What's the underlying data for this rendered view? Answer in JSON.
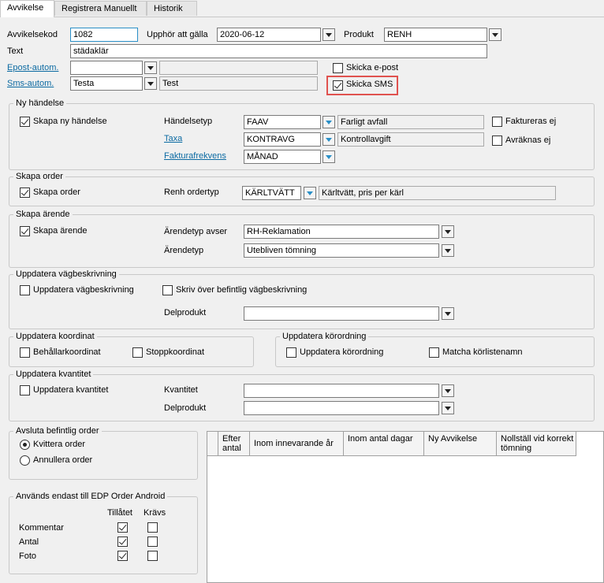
{
  "tabs": [
    "Avvikelse",
    "Registrera Manuellt",
    "Historik"
  ],
  "fields": {
    "avvikelsekod_label": "Avvikelsekod",
    "avvikelsekod": "1082",
    "upphor_label": "Upphör att gälla",
    "upphor": "2020-06-12",
    "produkt_label": "Produkt",
    "produkt": "RENH",
    "text_label": "Text",
    "text": "städaklär",
    "epost_label": "Epost-autom.",
    "epost": "",
    "epost_desc": "",
    "sms_label": "Sms-autom.",
    "sms": "Testa",
    "sms_desc": "Test",
    "skicka_epost": "Skicka e-post",
    "skicka_sms": "Skicka SMS"
  },
  "ny_handelse": {
    "title": "Ny händelse",
    "skapa": "Skapa ny händelse",
    "handelsetyp_label": "Händelsetyp",
    "handelsetyp": "FAAV",
    "handelsetyp_desc": "Farligt avfall",
    "taxa_label": "Taxa",
    "taxa": "KONTRAVG",
    "taxa_desc": "Kontrollavgift",
    "fakturafrekvens_label": "Fakturafrekvens",
    "fakturafrekvens": "MÅNAD",
    "faktureras_ej": "Faktureras ej",
    "avraknas_ej": "Avräknas ej"
  },
  "skapa_order": {
    "title": "Skapa order",
    "skapa": "Skapa order",
    "ordertyp_label": "Renh ordertyp",
    "ordertyp": "KÄRLTVÄTT",
    "ordertyp_desc": "Kärltvätt, pris per kärl"
  },
  "skapa_arende": {
    "title": "Skapa ärende",
    "skapa": "Skapa ärende",
    "avser_label": "Ärendetyp avser",
    "avser": "RH-Reklamation",
    "typ_label": "Ärendetyp",
    "typ": "Utebliven tömning"
  },
  "vagbeskrivning": {
    "title": "Uppdatera vägbeskrivning",
    "uppdatera": "Uppdatera vägbeskrivning",
    "skriv_over": "Skriv över befintlig vägbeskrivning",
    "delprodukt_label": "Delprodukt",
    "delprodukt": ""
  },
  "koordinat": {
    "title": "Uppdatera koordinat",
    "behallar": "Behållarkoordinat",
    "stopp": "Stoppkoordinat"
  },
  "korordning": {
    "title": "Uppdatera körordning",
    "uppdatera": "Uppdatera körordning",
    "matcha": "Matcha körlistenamn"
  },
  "kvantitet": {
    "title": "Uppdatera kvantitet",
    "uppdatera": "Uppdatera kvantitet",
    "kvantitet_label": "Kvantitet",
    "kvantitet": "",
    "delprodukt_label": "Delprodukt",
    "delprodukt": ""
  },
  "avsluta": {
    "title": "Avsluta befintlig order",
    "kvittera": "Kvittera order",
    "annullera": "Annullera order"
  },
  "edp": {
    "title": "Används endast till EDP Order Android",
    "col_tillatet": "Tillåtet",
    "col_kravs": "Krävs",
    "rows": [
      {
        "label": "Kommentar",
        "tillatet": true,
        "kravs": false
      },
      {
        "label": "Antal",
        "tillatet": true,
        "kravs": false
      },
      {
        "label": "Foto",
        "tillatet": true,
        "kravs": false
      }
    ]
  },
  "grid": {
    "columns": [
      "Efter antal",
      "Inom innevarande år",
      "Inom antal dagar",
      "Ny Avvikelse",
      "Nollställ vid korrekt tömning"
    ],
    "rows": []
  },
  "colors": {
    "highlight": "#e0524f",
    "link": "#0b6aa2",
    "dropdown_accent": "#2a8fc7"
  }
}
